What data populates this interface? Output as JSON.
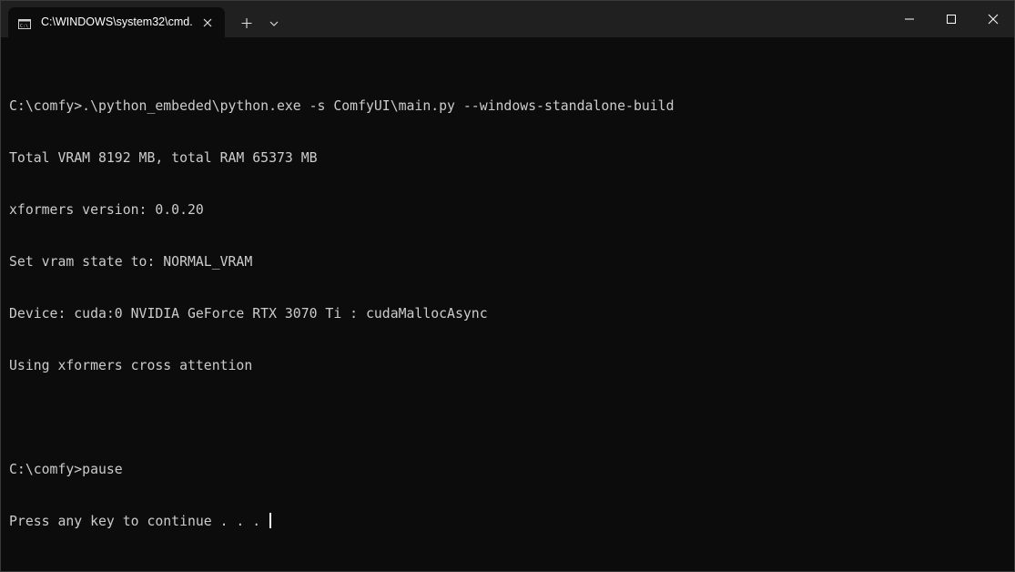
{
  "window": {
    "tab_title": "C:\\WINDOWS\\system32\\cmd.",
    "icons": {
      "tab_icon": "cmd-icon",
      "tab_close": "close-icon",
      "new_tab": "plus-icon",
      "dropdown": "chevron-down-icon",
      "minimize": "minimize-icon",
      "maximize": "maximize-icon",
      "close": "close-icon"
    }
  },
  "terminal": {
    "lines": [
      "",
      "C:\\comfy>.\\python_embeded\\python.exe -s ComfyUI\\main.py --windows-standalone-build",
      "Total VRAM 8192 MB, total RAM 65373 MB",
      "xformers version: 0.0.20",
      "Set vram state to: NORMAL_VRAM",
      "Device: cuda:0 NVIDIA GeForce RTX 3070 Ti : cudaMallocAsync",
      "Using xformers cross attention",
      "",
      "C:\\comfy>pause",
      "Press any key to continue . . . "
    ],
    "colors": {
      "background": "#0c0c0c",
      "foreground": "#cccccc",
      "titlebar": "#202020"
    }
  }
}
